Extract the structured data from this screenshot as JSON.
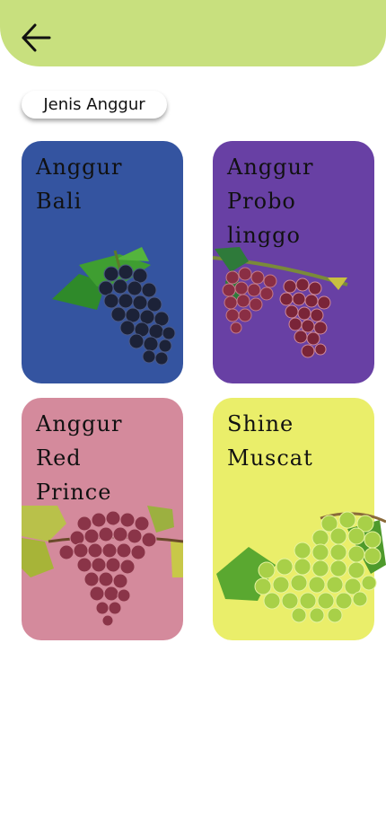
{
  "header": {
    "back_icon": "arrow-left-icon",
    "bar_color": "#c8e07e"
  },
  "filter_chip": {
    "label": "Jenis Anggur"
  },
  "cards": [
    {
      "title": "Anggur\nBali",
      "color": "#3454a0",
      "image": "dark-blue-grapes-image"
    },
    {
      "title": "Anggur\nProbo\nlinggo",
      "color": "#6840a4",
      "image": "red-grapes-on-vine-image"
    },
    {
      "title": "Anggur\nRed\nPrince",
      "color": "#d48a9c",
      "image": "red-prince-grapes-image"
    },
    {
      "title": "Shine\nMuscat",
      "color": "#eaee6a",
      "image": "green-muscat-grapes-image"
    }
  ]
}
